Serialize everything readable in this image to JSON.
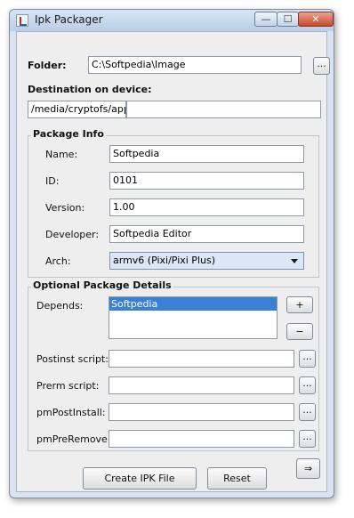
{
  "window": {
    "title": "Ipk Packager",
    "min_glyph": "—",
    "max_glyph": "☐",
    "close_glyph": "✕"
  },
  "folder": {
    "label": "Folder:",
    "value": "C:\\Softpedia\\Image",
    "browse_label": "..."
  },
  "destination": {
    "label": "Destination on device:",
    "value": "/media/cryptofs/apps",
    "value2": ""
  },
  "package_info": {
    "title": "Package Info",
    "name": {
      "label": "Name:",
      "value": "Softpedia"
    },
    "id": {
      "label": "ID:",
      "value": "0101"
    },
    "version": {
      "label": "Version:",
      "value": "1.00"
    },
    "developer": {
      "label": "Developer:",
      "value": "Softpedia Editor"
    },
    "arch": {
      "label": "Arch:",
      "value": "armv6  (Pixi/Pixi Plus)"
    }
  },
  "optional": {
    "title": "Optional Package Details",
    "depends": {
      "label": "Depends:",
      "items": [
        "Softpedia"
      ],
      "add_label": "+",
      "remove_label": "−"
    },
    "postinst": {
      "label": "Postinst script:",
      "value": "",
      "browse_label": "..."
    },
    "prerm": {
      "label": "Prerm script:",
      "value": "",
      "browse_label": "..."
    },
    "pmpostinstall": {
      "label": "pmPostInstall:",
      "value": "",
      "browse_label": "..."
    },
    "pmpreremove": {
      "label": "pmPreRemove:",
      "value": "",
      "browse_label": "..."
    }
  },
  "actions": {
    "create_label": "Create IPK File",
    "reset_label": "Reset",
    "next_label": "⇒"
  }
}
